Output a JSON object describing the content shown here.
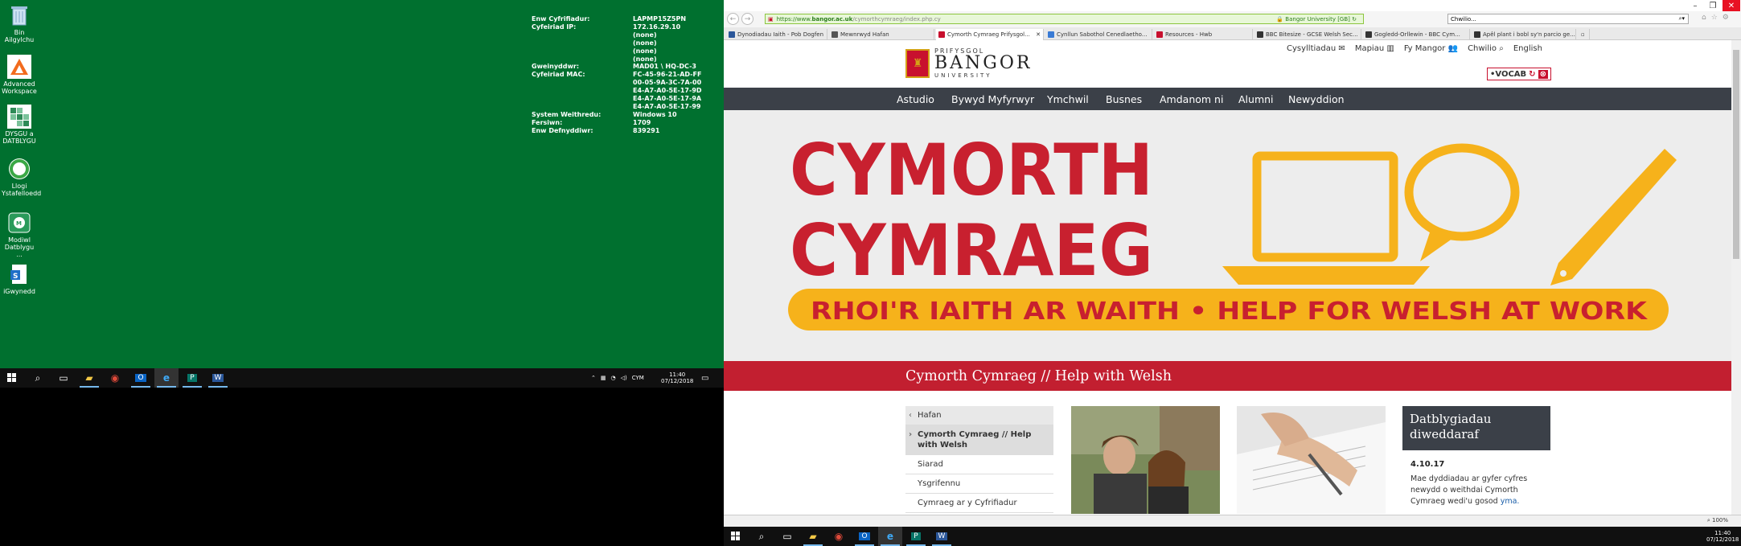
{
  "desktop": {
    "icons": [
      {
        "label": "Bin Ailgylchu",
        "icon": "recycle-bin-icon"
      },
      {
        "label": "Advanced Workspace",
        "icon": "advanced-workspace-icon"
      },
      {
        "label": "DYSGU a DATBLYGU",
        "icon": "dysgu-datblygu-icon"
      },
      {
        "label": "Llogi Ystafelloedd",
        "icon": "room-booking-icon"
      },
      {
        "label": "Modiwl Datblygu ...",
        "icon": "modiwl-icon"
      },
      {
        "label": "iGwynedd",
        "icon": "igwynedd-icon"
      }
    ],
    "sysinfo": [
      {
        "k": "Enw Cyfrifiadur:",
        "v": "LAPMP15Z5PN"
      },
      {
        "k": "Cyfeiriad IP:",
        "v": "172.16.29.10"
      },
      {
        "k": "",
        "v": "(none)"
      },
      {
        "k": "",
        "v": "(none)"
      },
      {
        "k": "",
        "v": "(none)"
      },
      {
        "k": "",
        "v": "(none)"
      },
      {
        "k": "Gweinyddwr:",
        "v": "MAD01 \\ HQ-DC-3"
      },
      {
        "k": "Cyfeiriad MAC:",
        "v": "FC-45-96-21-AD-FF"
      },
      {
        "k": "",
        "v": "00-05-9A-3C-7A-00"
      },
      {
        "k": "",
        "v": "E4-A7-A0-5E-17-9D"
      },
      {
        "k": "",
        "v": "E4-A7-A0-5E-17-9A"
      },
      {
        "k": "",
        "v": "E4-A7-A0-5E-17-99"
      },
      {
        "k": "System Weithredu:",
        "v": "Windows 10"
      },
      {
        "k": "Fersiwn:",
        "v": "1709"
      },
      {
        "k": "Enw Defnyddiwr:",
        "v": "839291"
      }
    ]
  },
  "taskbar": {
    "lang": "CYM",
    "time": "11:40",
    "date": "07/12/2018"
  },
  "browser": {
    "address_prefix": "https://www.",
    "address_domain": "bangor.ac.uk",
    "address_path": "/cymorthcymraeg/index.php.cy",
    "security_label": "Bangor University [GB]",
    "search_value": "Chwilio...",
    "tabs": [
      {
        "label": "Dynodiadau Iaith - Pob Dogfen",
        "color": "#2b579a"
      },
      {
        "label": "Mewnrwyd Hafan",
        "color": "#555555"
      },
      {
        "label": "Cymorth Cymraeg Prifysgol...",
        "color": "#c8102e"
      },
      {
        "label": "Cynllun Sabothol Cenedlaetho...",
        "color": "#3a7bd5"
      },
      {
        "label": "Resources - Hwb",
        "color": "#c8102e"
      },
      {
        "label": "BBC Bitesize - GCSE Welsh Sec...",
        "color": "#333333"
      },
      {
        "label": "Gogledd-Orllewin - BBC Cym...",
        "color": "#333333"
      },
      {
        "label": "Apêl plant i bobl sy'n parcio ge...",
        "color": "#333333"
      }
    ],
    "zoom": "100%"
  },
  "site": {
    "logo_top": "PRIFYSGOL",
    "logo_main": "BANGOR",
    "logo_bottom": "UNIVERSITY",
    "util_links": [
      "Cysylltiadau",
      "Mapiau",
      "Fy Mangor",
      "Chwilio",
      "English"
    ],
    "vocab": "VOCAB",
    "nav": [
      "Astudio",
      "Bywyd Myfyrwyr",
      "Ymchwil",
      "Busnes",
      "Amdanom ni",
      "Alumni",
      "Newyddion"
    ],
    "hero_line1": "CYMORTH",
    "hero_line2": "CYMRAEG",
    "hero_banner": "RHOI'R IAITH AR WAITH  •  HELP FOR WELSH AT WORK",
    "section_title": "Cymorth Cymraeg // Help with Welsh",
    "sidenav": [
      "Hafan",
      "Cymorth Cymraeg // Help with Welsh",
      "Siarad",
      "Ysgrifennu",
      "Cymraeg ar y Cyfrifiadur"
    ],
    "news_heading": "Datblygiadau diweddaraf",
    "news_date": "4.10.17",
    "news_text": "Mae dyddiadau ar gyfer cyfres newydd o weithdai Cymorth Cymraeg wedi'u gosod",
    "news_link": "yma."
  },
  "colors": {
    "desktop": "#00702f",
    "red": "#c21f30",
    "hero_red": "#c8202f",
    "hero_yellow": "#f6b21b",
    "nav_bg": "#3b4048"
  }
}
